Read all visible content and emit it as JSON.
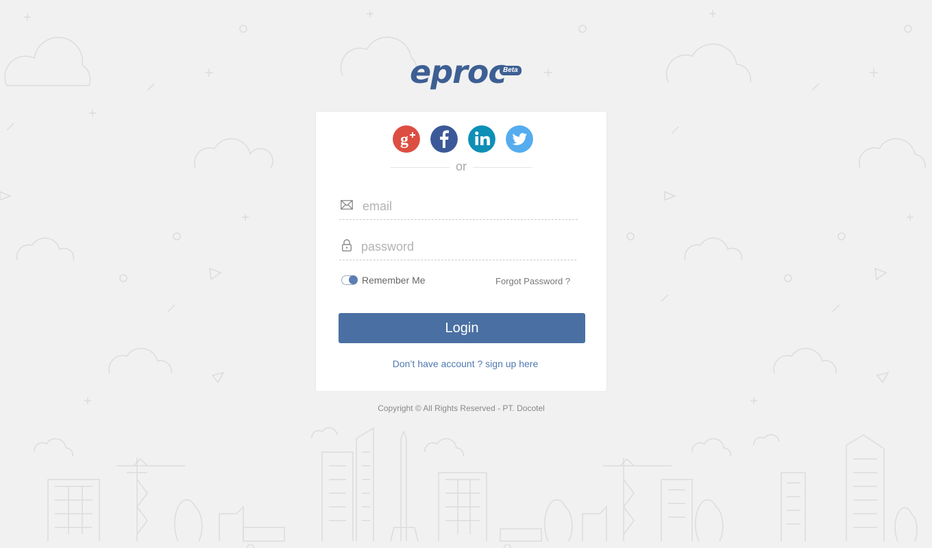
{
  "brand": {
    "name": "eproc",
    "badge": "Beta",
    "color": "#3d5f93"
  },
  "social": [
    {
      "name": "google-plus",
      "color": "#dc4e41"
    },
    {
      "name": "facebook",
      "color": "#3b5998"
    },
    {
      "name": "linkedin",
      "color": "#0e8fb6"
    },
    {
      "name": "twitter",
      "color": "#55acee"
    }
  ],
  "separator": "or",
  "form": {
    "email_placeholder": "email",
    "password_placeholder": "password",
    "remember_label": "Remember Me",
    "forgot_label": "Forgot Password ?",
    "login_label": "Login",
    "signup_label": "Don’t have account ? sign up here"
  },
  "footer": {
    "copyright": "Copyright © All Rights Reserved - PT. Docotel"
  },
  "colors": {
    "primary": "#4a70a3",
    "link": "#4e79b0",
    "background": "#f1f1f1"
  }
}
